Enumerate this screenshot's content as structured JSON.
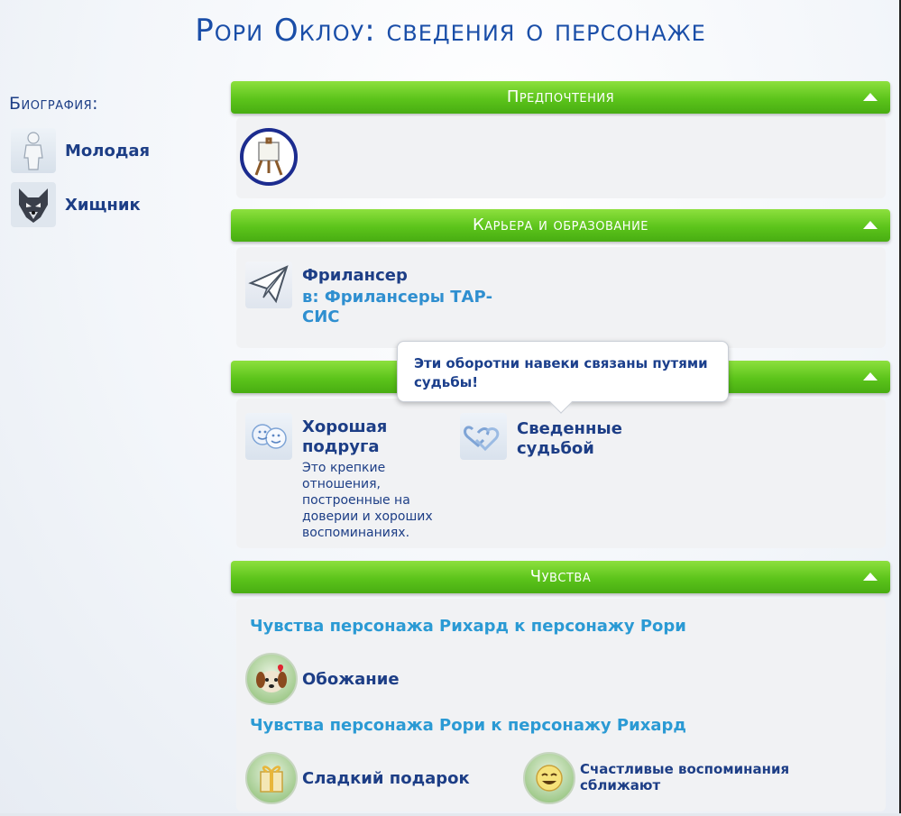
{
  "window": {
    "title": "Рори Оклоу: сведения о персонаже"
  },
  "bio": {
    "heading": "Биография:",
    "items": [
      {
        "label": "Молодая",
        "icon": "young-adult-icon"
      },
      {
        "label": "Хищник",
        "icon": "wolf-icon"
      }
    ]
  },
  "sections": {
    "preferences": {
      "title": "Предпочтения",
      "items": [
        {
          "icon": "easel-icon"
        }
      ]
    },
    "career": {
      "title": "Карьера и образование",
      "job": "Фрилансер",
      "organization": "в: Фрилансеры ТАР-СИС"
    },
    "relationships": {
      "tooltip": "Эти оборотни навеки связаны путями судьбы!",
      "items": [
        {
          "title": "Хорошая подруга",
          "description": "Это крепкие отношения, построенные на доверии и хороших воспоминаниях."
        },
        {
          "title": "Сведенные судьбой"
        }
      ]
    },
    "feelings": {
      "title": "Чувства",
      "group1": {
        "heading": "Чувства персонажа Рихард к персонажу Рори",
        "items": [
          {
            "label": "Обожание",
            "icon": "puppy-love-icon"
          }
        ]
      },
      "group2": {
        "heading": "Чувства персонажа Рори к персонажу Рихард",
        "items": [
          {
            "label": "Сладкий подарок",
            "icon": "gift-icon"
          },
          {
            "label": "Счастливые воспоминания сближают",
            "icon": "happy-face-icon"
          }
        ]
      }
    }
  },
  "colors": {
    "header_green": "#5cc41b",
    "title_blue": "#1a4ea8",
    "link_blue": "#2b9ad4"
  }
}
